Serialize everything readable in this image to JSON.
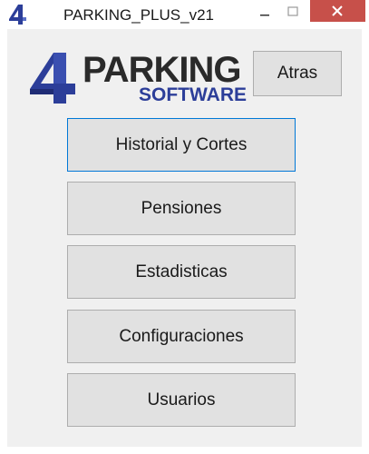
{
  "window": {
    "title": "PARKING_PLUS_v21",
    "icon": "app-four-logo-icon",
    "controls": [
      "minimize-icon",
      "maximize-icon",
      "close-icon"
    ],
    "close_color": "#c7504a"
  },
  "logo": {
    "mark": "4",
    "main_text": "PARKING",
    "sub_text": "SOFTWARE",
    "mark_color": "#2c3e99",
    "sub_color": "#2c3e99"
  },
  "header": {
    "back_label": "Atras"
  },
  "menu": {
    "items": [
      {
        "label": "Historial y Cortes",
        "focused": true
      },
      {
        "label": "Pensiones",
        "focused": false
      },
      {
        "label": "Estadisticas",
        "focused": false
      },
      {
        "label": "Configuraciones",
        "focused": false
      },
      {
        "label": "Usuarios",
        "focused": false
      }
    ]
  }
}
